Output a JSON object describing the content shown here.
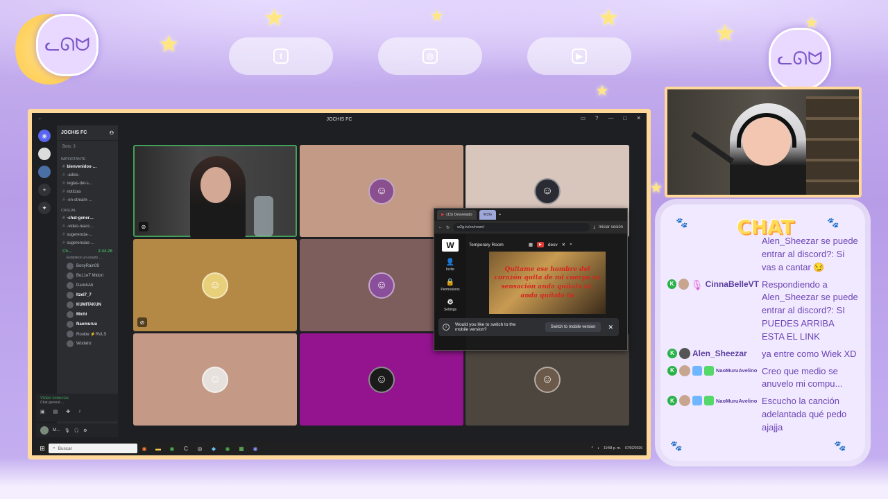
{
  "colors": {
    "background": "#c4aef0",
    "discord_dark": "#1e1f22",
    "discord_panel": "#2b2d31",
    "speaking_green": "#43a25a",
    "frame_border": "#ffd89a",
    "chat_bg": "#f1e9ff",
    "chat_text": "#6b44b5",
    "chat_title": "#ffdc58"
  },
  "overlay": {
    "social_icons": [
      "twitter-icon",
      "instagram-icon",
      "youtube-icon"
    ]
  },
  "discord": {
    "window_title": "JOCHIS FC",
    "server_name": "JOCHIS FC",
    "bots": "Bots: 3",
    "categories": [
      {
        "name": "IMPORTANTE",
        "channels": [
          "bienvenidos-…",
          "-adios-",
          "reglas-del-s…",
          "noticias",
          "-en-stream-…"
        ]
      },
      {
        "name": "CASUAL",
        "channels": [
          "-chat-gener…",
          "-video-reacc…",
          "sugerencia-…",
          "sugerencias-…"
        ]
      }
    ],
    "voice_channel": {
      "name": "Ch…",
      "timer": "2:44:26",
      "status": "Establece un estado …",
      "users": [
        "BonyRain09",
        "BuL1eT Mldori",
        "DarickAb",
        "Itzel7_7",
        "KUMITAKUN",
        "Michi",
        "Naomuruu",
        "Rookie ⚡RVLS",
        "Wodahz"
      ]
    },
    "voice_panel": {
      "title": "Vídeo conectac",
      "subtitle": "Chat general ..."
    },
    "user_panel": {
      "name": "M…"
    },
    "grid": {
      "tiles": [
        {
          "kind": "camera",
          "bg": "#3a3a3a"
        },
        {
          "kind": "avatar",
          "bg": "#c39a85"
        },
        {
          "kind": "avatar",
          "bg": "#d8c6bd"
        },
        {
          "kind": "avatar",
          "bg": "#b48845"
        },
        {
          "kind": "avatar",
          "bg": "#7e5d5d"
        },
        {
          "kind": "avatar",
          "bg": "#c89c86"
        },
        {
          "kind": "avatar",
          "bg": "#c49a87"
        },
        {
          "kind": "avatar",
          "bg": "#941490"
        },
        {
          "kind": "avatar",
          "bg": "#4c463f"
        }
      ]
    },
    "taskbar": {
      "search_placeholder": "Buscar",
      "time": "10:58 p. m.",
      "date": "07/02/2026"
    }
  },
  "browser": {
    "tabs": [
      "(15) Desvelado",
      "W2G"
    ],
    "url": "w2g.tv/en/room/",
    "sign_in": "Iniciar sesión",
    "room_title": "Temporary Room",
    "search_value": "desv",
    "side_buttons": [
      "Invite",
      "Permissions",
      "Settings"
    ],
    "video_lyrics": "Quitame ese hombre del corazón quita de mi cuerpo su sensación anda quítalo tú, anda quítalo tú",
    "mobile_prompt": "Would you like to switch to the mobile version?",
    "switch_button": "Switch to mobile version"
  },
  "chat": {
    "title": "CHAT",
    "messages": [
      {
        "continuation": true,
        "text": "Alen_Sheezar se puede entrar al discord?: Si vas a cantar 😏"
      },
      {
        "user": "CinnaBelleVT",
        "text": "Respondiendo a Alen_Sheezar se puede entrar al discord?: SI PUEDES ARRIBA ESTA EL LINK"
      },
      {
        "user": "Alen_Sheezar",
        "text": "ya entre como Wiek XD"
      },
      {
        "user": "NaoMuruAvelino",
        "text": "Creo que medio se anuvelo mi compu..."
      },
      {
        "user": "NaoMuruAvelino",
        "text": "Escucho la canción adelantada qué pedo ajajja"
      }
    ]
  }
}
